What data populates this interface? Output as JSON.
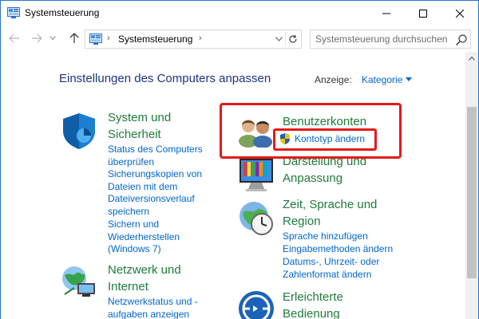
{
  "window": {
    "title": "Systemsteuerung",
    "buttons": {
      "minimize": "minimize",
      "maximize": "maximize",
      "close": "close"
    }
  },
  "address": {
    "path": "Systemsteuerung",
    "search_placeholder": "Systemsteuerung durchsuchen"
  },
  "main": {
    "heading": "Einstellungen des Computers anpassen",
    "view_label": "Anzeige:",
    "view_value": "Kategorie"
  },
  "categories": {
    "system": {
      "title": "System und Sicherheit",
      "links": [
        "Status des Computers überprüfen",
        "Sicherungskopien von Dateien mit dem Dateiversionsverlauf speichern",
        "Sichern und Wiederherstellen (Windows 7)"
      ]
    },
    "network": {
      "title": "Netzwerk und Internet",
      "links": [
        "Netzwerkstatus und -aufgaben anzeigen"
      ]
    },
    "accounts": {
      "title": "Benutzerkonten",
      "links": [
        "Kontotyp ändern"
      ]
    },
    "appearance": {
      "title": "Darstellung und Anpassung"
    },
    "clock": {
      "title": "Zeit, Sprache und Region",
      "links": [
        "Sprache hinzufügen",
        "Eingabemethoden ändern",
        "Datums-, Uhrzeit- oder Zahlenformat ändern"
      ]
    },
    "ease": {
      "title": "Erleichterte Bedienung"
    }
  },
  "colors": {
    "heading": "#1e3287",
    "category_title": "#1e7b3c",
    "link": "#0066cc",
    "highlight": "#e51a1a"
  }
}
